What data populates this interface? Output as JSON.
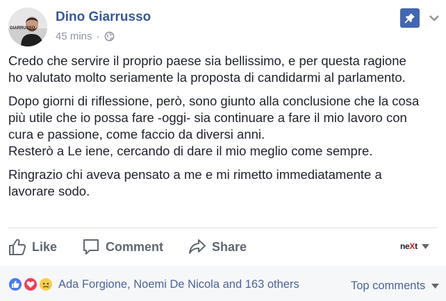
{
  "post": {
    "author": "Dino Giarrusso",
    "avatar_text": "GIARRUSSO",
    "time": "45 mins",
    "separator": "·",
    "privacy_icon": "globe-icon",
    "paragraphs": [
      "Credo che servire il proprio paese sia bellissimo, e per questa ragione\nho valutato molto seriamente la proposta di candidarmi al parlamento.",
      "Dopo giorni di riflessione, però, sono giunto alla conclusione che la cosa\npiù utile che io possa fare -oggi- sia continuare a fare il mio lavoro con\ncura e passione, come faccio da diversi anni.\nResterò a Le iene, cercando di dare il mio meglio come sempre.",
      "Ringrazio chi aveva pensato a me e mi rimetto immediatamente a\nlavorare sodo."
    ]
  },
  "actions": {
    "like_label": "Like",
    "comment_label": "Comment",
    "share_label": "Share"
  },
  "next_logo": {
    "prefix": "ne",
    "accent": "X",
    "suffix": "t"
  },
  "footer": {
    "reactions": [
      "like",
      "love",
      "sad"
    ],
    "reactors_text": "Ada Forgione, Noemi De Nicola and 163 others",
    "sort_label": "Top comments"
  },
  "colors": {
    "link_blue": "#365899",
    "pin_blue": "#4267b2",
    "muted_gray": "#90949c",
    "action_gray": "#606770",
    "like_blue": "#4b7bef",
    "love_red": "#ef3d57",
    "sad_yellow": "#f8cf48"
  }
}
